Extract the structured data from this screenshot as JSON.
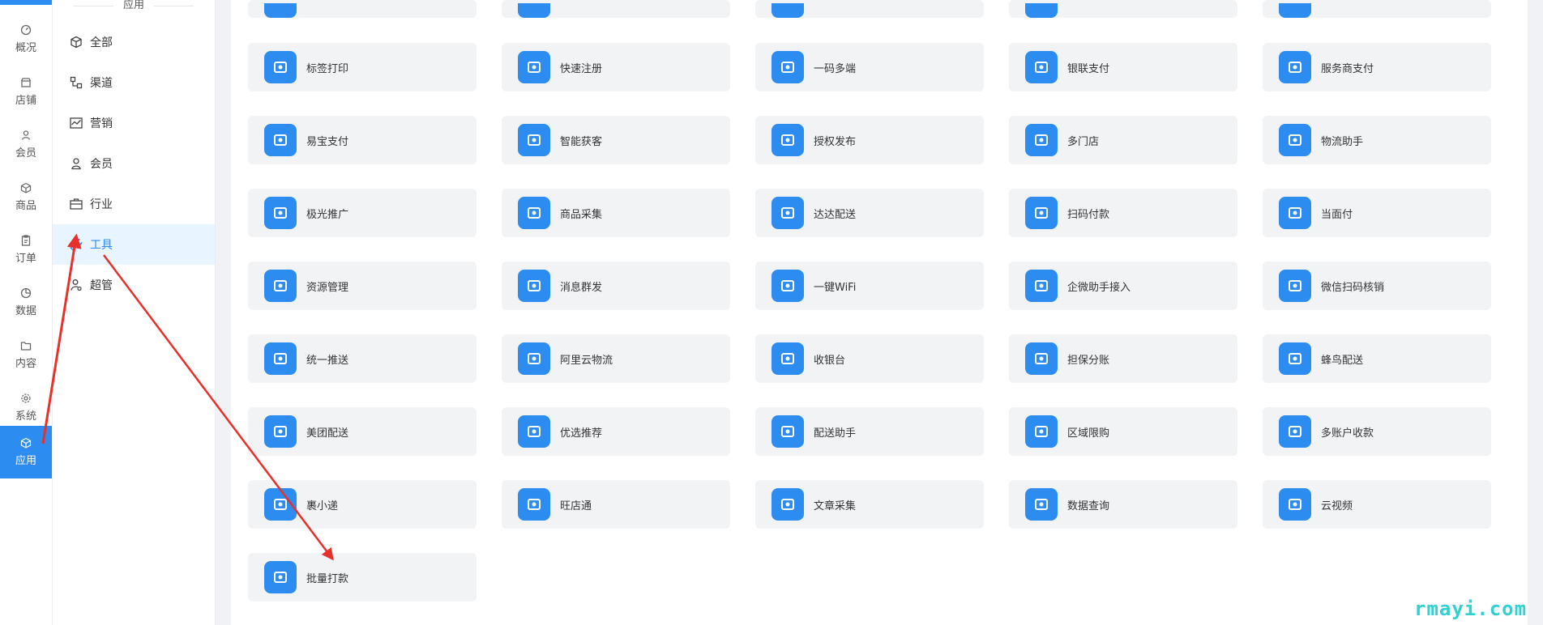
{
  "rail": {
    "items": [
      {
        "label": "概况",
        "icon": "dashboard-icon"
      },
      {
        "label": "店铺",
        "icon": "shop-icon"
      },
      {
        "label": "会员",
        "icon": "member-icon"
      },
      {
        "label": "商品",
        "icon": "goods-icon"
      },
      {
        "label": "订单",
        "icon": "order-icon"
      },
      {
        "label": "数据",
        "icon": "data-icon"
      },
      {
        "label": "内容",
        "icon": "content-icon"
      },
      {
        "label": "系统",
        "icon": "settings-icon"
      },
      {
        "label": "应用",
        "icon": "app-icon",
        "active": true
      }
    ]
  },
  "submenu": {
    "title": "应用",
    "items": [
      {
        "label": "全部",
        "icon": "cube-icon"
      },
      {
        "label": "渠道",
        "icon": "channel-icon"
      },
      {
        "label": "营销",
        "icon": "chart-icon"
      },
      {
        "label": "会员",
        "icon": "user-icon"
      },
      {
        "label": "行业",
        "icon": "briefcase-icon"
      },
      {
        "label": "工具",
        "icon": "wrench-icon",
        "active": true
      },
      {
        "label": "超管",
        "icon": "admin-icon"
      }
    ]
  },
  "apps": [
    {
      "label": "标签打印",
      "icon": "printer-icon"
    },
    {
      "label": "快速注册",
      "icon": "user-add-icon"
    },
    {
      "label": "一码多端",
      "icon": "devices-icon"
    },
    {
      "label": "银联支付",
      "icon": "card-icon"
    },
    {
      "label": "服务商支付",
      "icon": "wallet-icon"
    },
    {
      "label": "易宝支付",
      "icon": "check-bubble-icon"
    },
    {
      "label": "智能获客",
      "icon": "users-icon"
    },
    {
      "label": "授权发布",
      "icon": "upload-icon"
    },
    {
      "label": "多门店",
      "icon": "store-icon"
    },
    {
      "label": "物流助手",
      "icon": "logistics-search-icon"
    },
    {
      "label": "极光推广",
      "icon": "sun-bolt-icon"
    },
    {
      "label": "商品采集",
      "icon": "jar-icon"
    },
    {
      "label": "达达配送",
      "icon": "truck-icon"
    },
    {
      "label": "扫码付款",
      "icon": "barcode-icon"
    },
    {
      "label": "当面付",
      "icon": "nfc-icon"
    },
    {
      "label": "资源管理",
      "icon": "sliders-icon"
    },
    {
      "label": "消息群发",
      "icon": "send-icon"
    },
    {
      "label": "一键WiFi",
      "icon": "rss-icon"
    },
    {
      "label": "企微助手接入",
      "icon": "folder-icon"
    },
    {
      "label": "微信扫码核销",
      "icon": "scan-wechat-icon"
    },
    {
      "label": "统一推送",
      "icon": "push-icon"
    },
    {
      "label": "阿里云物流",
      "icon": "aliyun-icon"
    },
    {
      "label": "收银台",
      "icon": "cashier-icon"
    },
    {
      "label": "担保分账",
      "icon": "yen-icon"
    },
    {
      "label": "蜂鸟配送",
      "icon": "bird-icon"
    },
    {
      "label": "美团配送",
      "icon": "meituan-icon"
    },
    {
      "label": "优选推荐",
      "icon": "thumb-up-icon"
    },
    {
      "label": "配送助手",
      "icon": "monitor-icon"
    },
    {
      "label": "区域限购",
      "icon": "map-icon"
    },
    {
      "label": "多账户收款",
      "icon": "user-coin-icon"
    },
    {
      "label": "裹小递",
      "icon": "parcel-icon"
    },
    {
      "label": "旺店通",
      "icon": "swirl-icon"
    },
    {
      "label": "文章采集",
      "icon": "article-icon"
    },
    {
      "label": "数据查询",
      "icon": "user-search-icon"
    },
    {
      "label": "云视频",
      "icon": "video-jar-icon"
    },
    {
      "label": "批量打款",
      "icon": "batch-pay-icon"
    }
  ],
  "watermark": "rmayi.com",
  "colors": {
    "accent": "#2d8cf0",
    "arrow": "#e8302b",
    "card": "#f2f3f5"
  }
}
